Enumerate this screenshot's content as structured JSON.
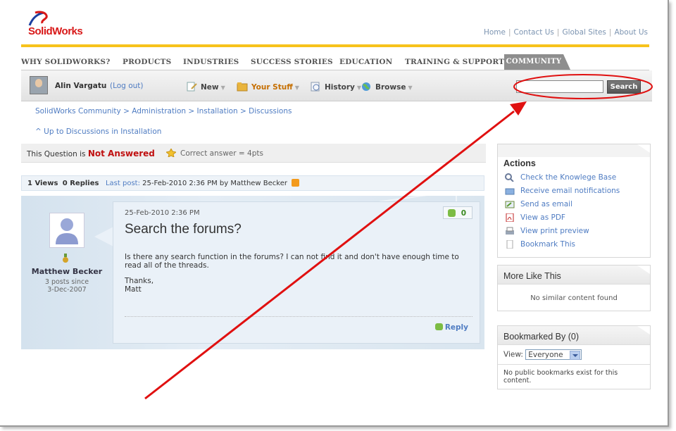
{
  "brand": {
    "name": "SolidWorks"
  },
  "top_links": [
    "Home",
    "Contact Us",
    "Global Sites",
    "About Us"
  ],
  "top_links_sep": "|",
  "nav": {
    "items": [
      "WHY SOLIDWORKS?",
      "PRODUCTS",
      "INDUSTRIES",
      "SUCCESS STORIES",
      "EDUCATION",
      "TRAINING & SUPPORT"
    ],
    "active": "COMMUNITY"
  },
  "user": {
    "name": "Alin Vargatu",
    "logout": "(Log out)"
  },
  "menus": {
    "new": "New",
    "your_stuff": "Your Stuff",
    "history": "History",
    "browse": "Browse"
  },
  "search": {
    "button": "Search",
    "value": ""
  },
  "breadcrumb": "SolidWorks Community > Administration > Installation > Discussions",
  "up_link": "^ Up to Discussions in Installation",
  "status": {
    "prefix": "This Question is",
    "state": "Not Answered",
    "correct": "Correct answer = 4pts"
  },
  "info": {
    "views": "1 Views",
    "replies": "0 Replies",
    "last_post": "Last post:",
    "last_post_detail": "25-Feb-2010 2:36 PM by Matthew Becker"
  },
  "post": {
    "date": "25-Feb-2010 2:36 PM",
    "title": "Search the forums?",
    "body": "Is there any search function in the forums?  I can not find it and don't have enough time to read all of the threads.",
    "sign1": "Thanks,",
    "sign2": "Matt",
    "votes": "0",
    "reply": "Reply"
  },
  "author": {
    "name": "Matthew Becker",
    "posts": "3 posts since",
    "since": "3-Dec-2007"
  },
  "actions": {
    "title": "Actions",
    "items": [
      "Check the Knowlege Base",
      "Receive email notifications",
      "Send as email",
      "View as PDF",
      "View print preview",
      "Bookmark This"
    ]
  },
  "more_like": {
    "title": "More Like This",
    "empty": "No similar content found"
  },
  "bookmarked": {
    "title": "Bookmarked By (0)",
    "view_label": "View:",
    "view_value": "Everyone",
    "empty": "No public bookmarks exist for this content."
  },
  "colors": {
    "accent": "#f7c31c",
    "link": "#4f7cc2",
    "annotation": "#e01010",
    "status": "#c01010"
  }
}
